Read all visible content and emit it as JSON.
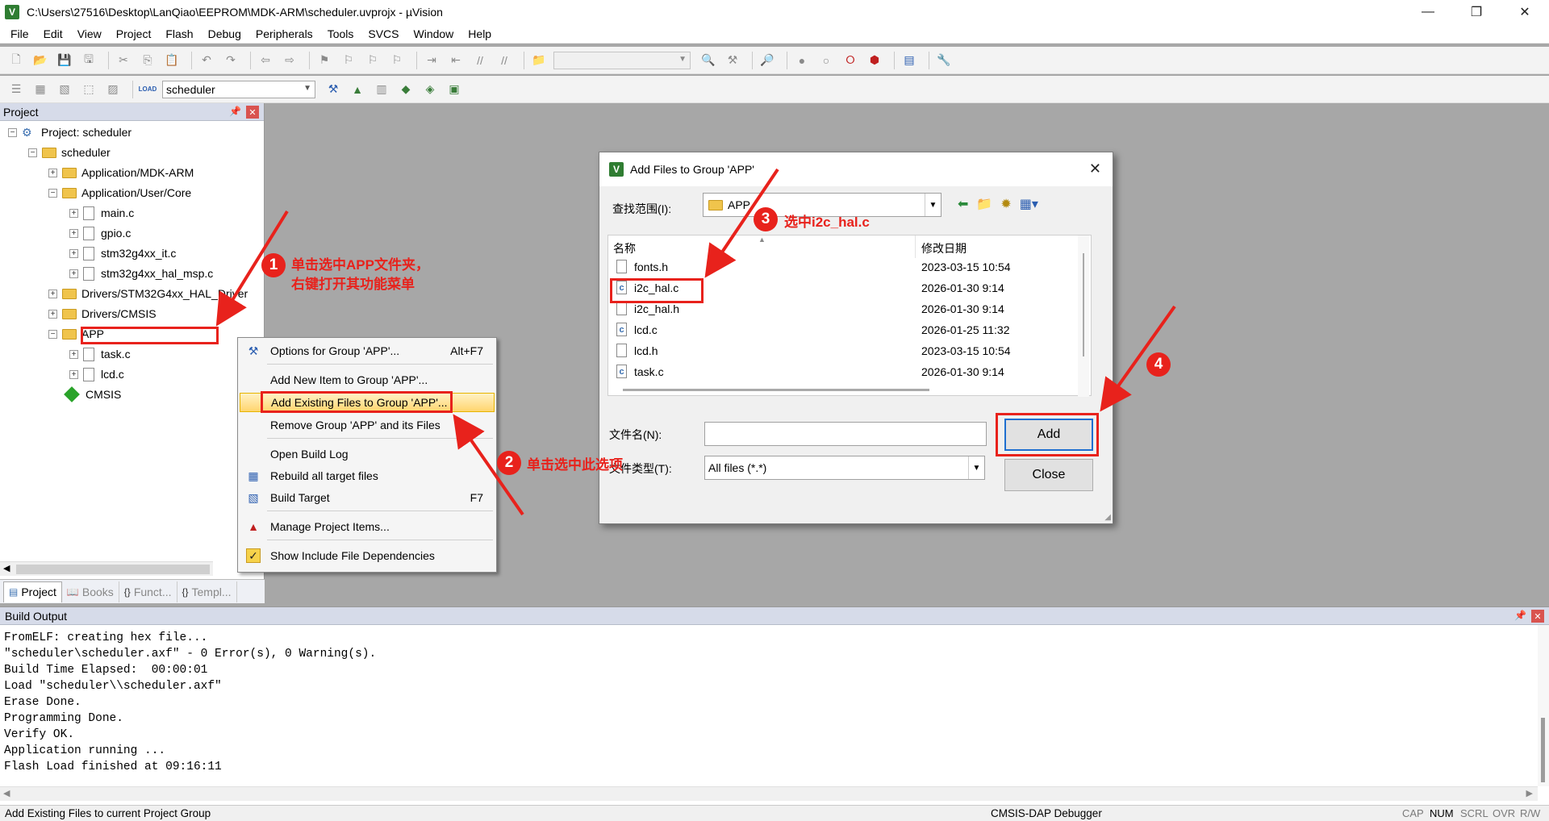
{
  "window": {
    "title": "C:\\Users\\27516\\Desktop\\LanQiao\\EEPROM\\MDK-ARM\\scheduler.uvprojx - µVision",
    "icon_letter": "V",
    "minimize_icon": "minimize-icon",
    "maximize_icon": "restore-icon",
    "close_icon": "close-icon"
  },
  "menu": [
    "File",
    "Edit",
    "View",
    "Project",
    "Flash",
    "Debug",
    "Peripherals",
    "Tools",
    "SVCS",
    "Window",
    "Help"
  ],
  "toolbar2": {
    "target": "scheduler",
    "load_label": "LOAD"
  },
  "project_panel": {
    "title": "Project",
    "tree": {
      "root": "Project: scheduler",
      "target": "scheduler",
      "g1": "Application/MDK-ARM",
      "g2": "Application/User/Core",
      "f1": "main.c",
      "f2": "gpio.c",
      "f3": "stm32g4xx_it.c",
      "f4": "stm32g4xx_hal_msp.c",
      "g3": "Drivers/STM32G4xx_HAL_Driver",
      "g4": "Drivers/CMSIS",
      "g5": "APP",
      "f5": "task.c",
      "f6": "lcd.c",
      "g6": "CMSIS"
    },
    "tabs": {
      "t1": "Project",
      "t2": "Books",
      "t3": "Funct...",
      "t4": "Templ..."
    }
  },
  "context_menu": {
    "options": {
      "label": "Options for Group 'APP'...",
      "shortcut": "Alt+F7"
    },
    "add_new": "Add New  Item to Group 'APP'...",
    "add_existing": "Add Existing Files to Group 'APP'...",
    "remove": "Remove Group 'APP' and its Files",
    "open_log": "Open Build Log",
    "rebuild": "Rebuild all target files",
    "build": {
      "label": "Build Target",
      "shortcut": "F7"
    },
    "manage": "Manage Project Items...",
    "show_deps": "Show Include File Dependencies"
  },
  "dialog": {
    "title": "Add Files to Group 'APP'",
    "look_in_label": "查找范围(I):",
    "look_in_value": "APP",
    "col_name": "名称",
    "col_date": "修改日期",
    "files": [
      {
        "name": "fonts.h",
        "date": "2023-03-15 10:54",
        "type": "h"
      },
      {
        "name": "i2c_hal.c",
        "date": "2026-01-30 9:14",
        "type": "c"
      },
      {
        "name": "i2c_hal.h",
        "date": "2026-01-30 9:14",
        "type": "h"
      },
      {
        "name": "lcd.c",
        "date": "2026-01-25 11:32",
        "type": "c"
      },
      {
        "name": "lcd.h",
        "date": "2023-03-15 10:54",
        "type": "h"
      },
      {
        "name": "task.c",
        "date": "2026-01-30 9:14",
        "type": "c"
      }
    ],
    "file_name_label": "文件名(N):",
    "file_name_value": "",
    "file_type_label": "文件类型(T):",
    "file_type_value": "All files (*.*)",
    "add_label": "Add",
    "close_label": "Close"
  },
  "build_output": {
    "title": "Build Output",
    "lines": [
      "FromELF: creating hex file...",
      "\"scheduler\\scheduler.axf\" - 0 Error(s), 0 Warning(s).",
      "Build Time Elapsed:  00:00:01",
      "Load \"scheduler\\\\scheduler.axf\"",
      "Erase Done.",
      "Programming Done.",
      "Verify OK.",
      "Application running ...",
      "Flash Load finished at 09:16:11"
    ]
  },
  "status": {
    "message": "Add Existing Files to current Project Group",
    "debugger": "CMSIS-DAP Debugger",
    "cap": "CAP",
    "num": "NUM",
    "scrl": "SCRL",
    "ovr": "OVR",
    "rw": "R/W"
  },
  "annotations": {
    "step1_num": "1",
    "step1_text1": "单击选中APP文件夹，",
    "step1_text2": "右键打开其功能菜单",
    "step2_num": "2",
    "step2_text": "单击选中此选项",
    "step3_num": "3",
    "step3_text": "选中i2c_hal.c",
    "step4_num": "4",
    "color": "#e8221c"
  }
}
